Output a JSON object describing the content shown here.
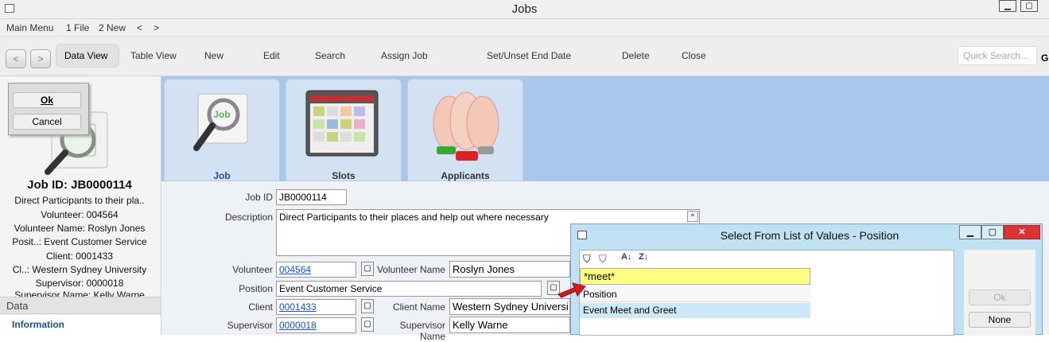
{
  "window": {
    "title": "Jobs"
  },
  "menu": [
    "Main Menu",
    "1 File",
    "2 New",
    "<",
    ">"
  ],
  "toolbar": {
    "back": "<",
    "forward": ">",
    "data_view": "Data View",
    "table_view": "Table View",
    "new": "New",
    "edit": "Edit",
    "search": "Search",
    "assign_job": "Assign Job",
    "set_unset_end_date": "Set/Unset End Date",
    "delete": "Delete",
    "close": "Close",
    "quick_search_placeholder": "Quick Search...",
    "overflow": "G"
  },
  "dialog": {
    "ok": "Ok",
    "cancel": "Cancel"
  },
  "summary": {
    "job_id": "Job ID: JB0000114",
    "description": "Direct Participants to their pla..",
    "volunteer": "Volunteer: 004564",
    "volunteer_name": "Volunteer Name:  Roslyn Jones",
    "position": "Posit..: Event Customer Service",
    "client": "Client: 0001433",
    "client_name": "Cl..:    Western Sydney University",
    "supervisor": "Supervisor: 0000018",
    "supervisor_name": "Supervisor Name:   Kelly Warne"
  },
  "left_nav": {
    "section": "Data",
    "item": "Information"
  },
  "tabs": [
    {
      "label": "Job"
    },
    {
      "label": "Slots"
    },
    {
      "label": "Applicants"
    }
  ],
  "form": {
    "job_id_label": "Job ID",
    "job_id": "JB0000114",
    "description_label": "Description",
    "description": "Direct Participants to their places and help out where necessary",
    "volunteer_label": "Volunteer",
    "volunteer": "004564",
    "volunteer_name_label": "Volunteer Name",
    "volunteer_name": "Roslyn Jones",
    "position_label": "Position",
    "position": "Event Customer Service",
    "client_label": "Client",
    "client": "0001433",
    "client_name_label": "Client Name",
    "client_name": "Western Sydney Universi",
    "supervisor_label": "Supervisor",
    "supervisor": "0000018",
    "supervisor_name_label": "Supervisor Name",
    "supervisor_name": "Kelly Warne"
  },
  "popup": {
    "title": "Select From List of Values - Position",
    "filter_value": "*meet*",
    "column_header": "Position",
    "rows": [
      "Event Meet and Greet"
    ],
    "ok": "Ok",
    "none": "None"
  },
  "colors": {
    "tab_strip": "#a9c7e8",
    "popup_bg": "#bfe1f3",
    "filter_highlight": "#ffff80",
    "selected_row": "#cde8f7"
  }
}
